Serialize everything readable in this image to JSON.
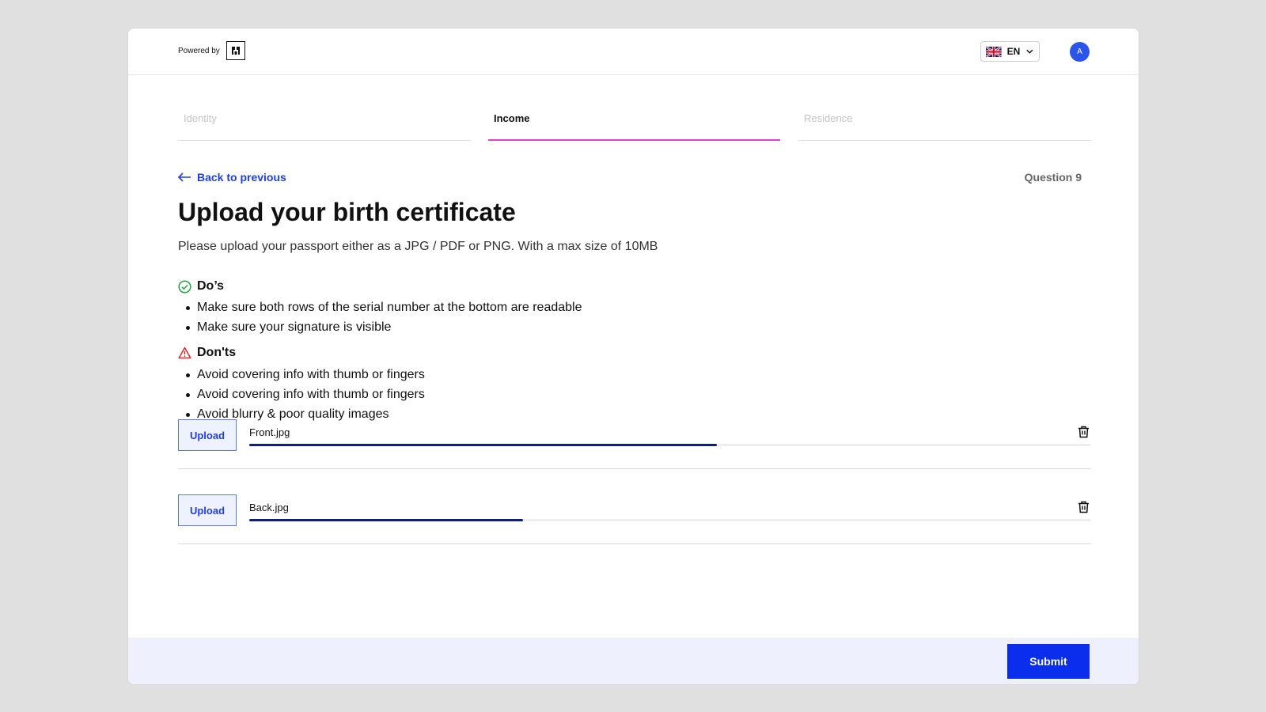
{
  "header": {
    "powered_by": "Powered by",
    "language": {
      "code": "EN",
      "flag": "uk-flag-icon"
    },
    "avatar_initial": "A"
  },
  "steps": [
    {
      "label": "Identity",
      "state": "inactive"
    },
    {
      "label": "Income",
      "state": "active"
    },
    {
      "label": "Residence",
      "state": "inactive"
    }
  ],
  "nav": {
    "back_label": "Back to previous",
    "question_label": "Question 9"
  },
  "main": {
    "title": "Upload your birth certificate",
    "subtitle": "Please upload your passport either as a JPG / PDF or PNG. With a max size of 10MB"
  },
  "dos": {
    "heading": "Do’s",
    "items": [
      "Make sure both rows of the serial number at the bottom are readable",
      "Make sure your signature is visible"
    ]
  },
  "donts": {
    "heading": "Don'ts",
    "items": [
      "Avoid covering info with thumb or fingers",
      "Avoid covering info with thumb or fingers",
      "Avoid blurry & poor quality images"
    ]
  },
  "uploads": [
    {
      "button_label": "Upload",
      "file_name": "Front.jpg",
      "progress": 0.555
    },
    {
      "button_label": "Upload",
      "file_name": "Back.jpg",
      "progress": 0.325
    }
  ],
  "footer": {
    "submit_label": "Submit"
  },
  "colors": {
    "accent": "#0b2eec",
    "link": "#1f3fde",
    "active_step": "#e33fd1",
    "progress": "#0e1f7a",
    "do_icon": "#22a447",
    "dont_icon": "#e0262d",
    "avatar": "#2a55e8"
  }
}
